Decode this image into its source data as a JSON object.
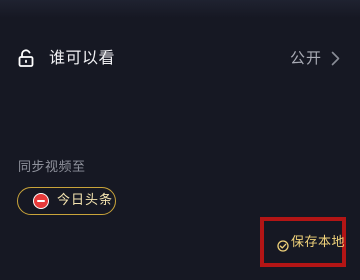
{
  "privacy": {
    "label": "谁可以看",
    "value": "公开",
    "icon": "unlock-icon"
  },
  "sync": {
    "label": "同步视频至",
    "targets": [
      {
        "label": "今日头条",
        "icon": "toutiao-logo"
      }
    ]
  },
  "save_local": {
    "label": "保存本地",
    "checked": true,
    "icon": "check-circle-icon"
  },
  "colors": {
    "background": "#161823",
    "accent_gold": "#c9a43a",
    "highlight_red": "#b31515",
    "toutiao_red": "#e63a3a"
  }
}
